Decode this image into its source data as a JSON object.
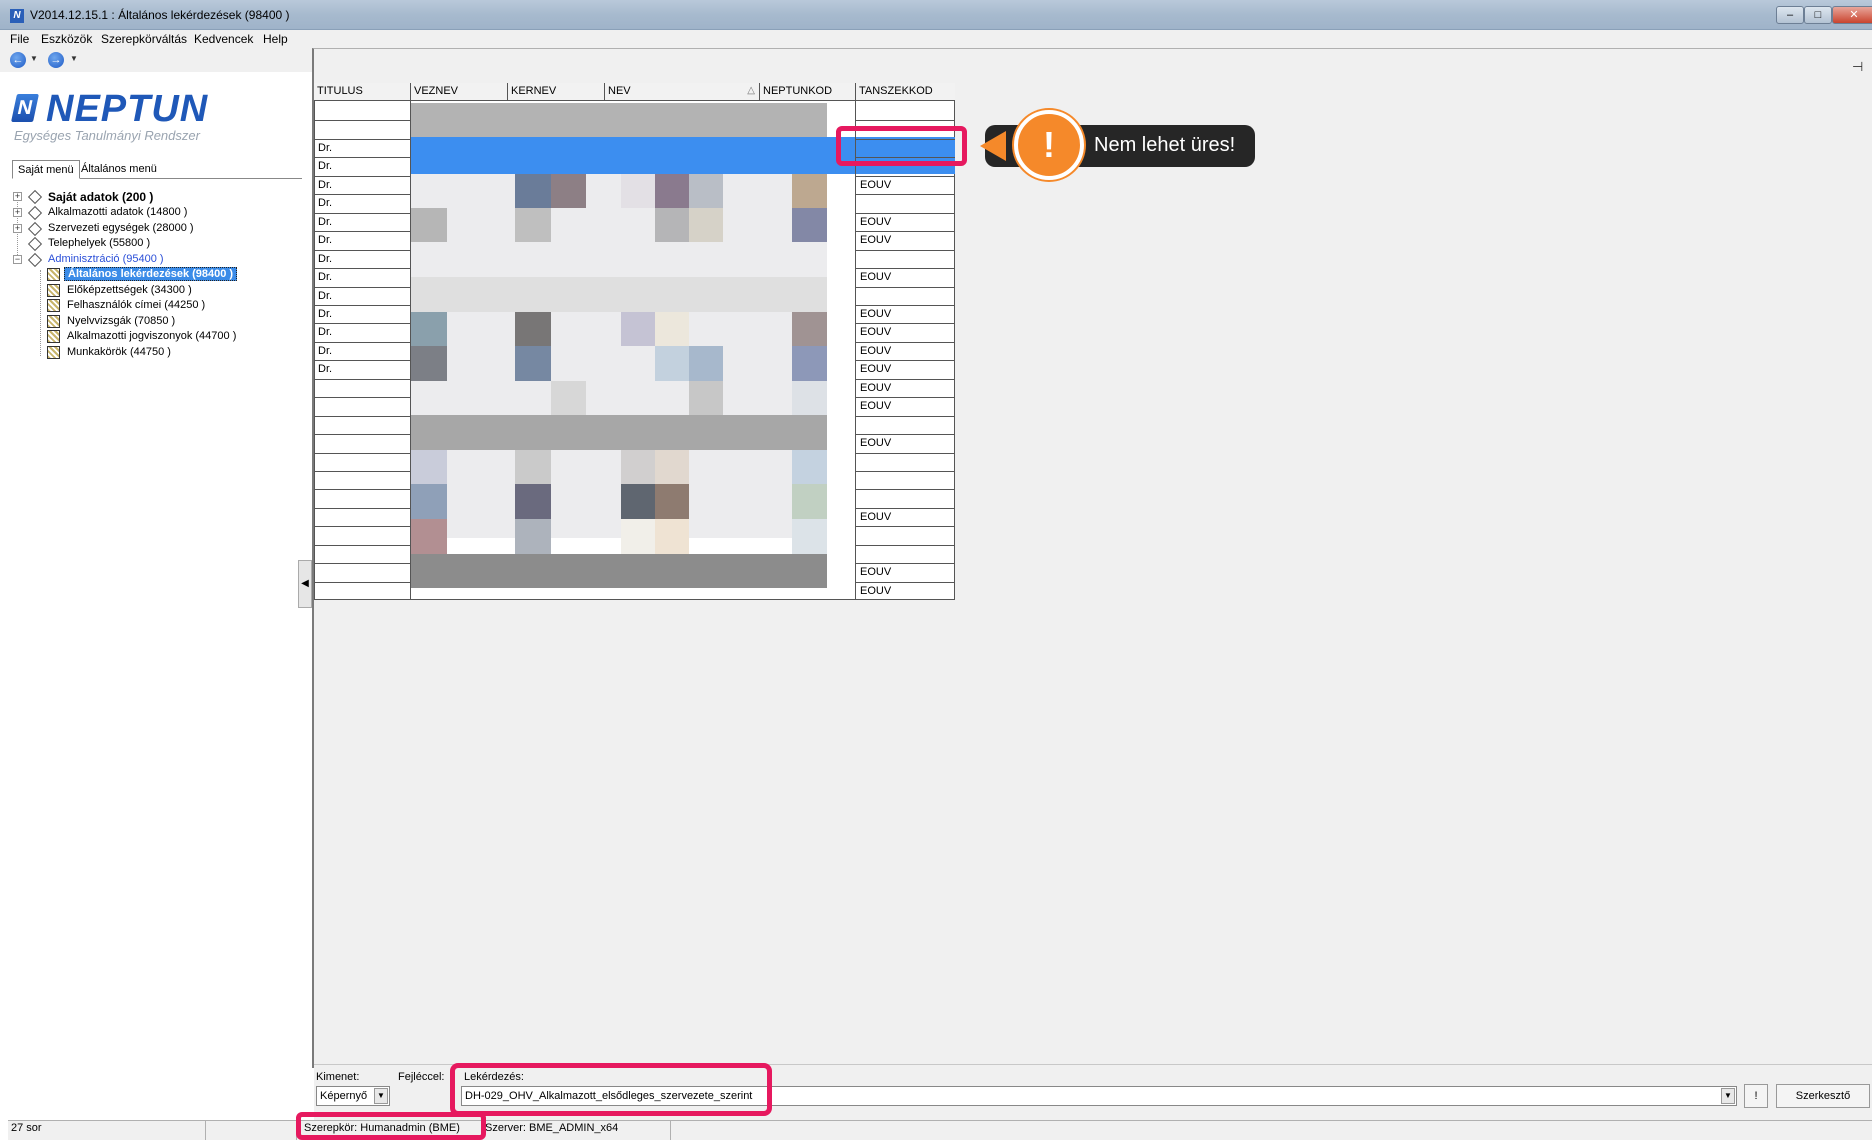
{
  "window": {
    "title": "V2014.12.15.1 : Általános lekérdezések (98400 )",
    "minimize": "–",
    "restore": "□",
    "close": "✕"
  },
  "menubar": {
    "items": [
      "File",
      "Eszközök",
      "Szerepkörváltás",
      "Kedvencek",
      "Help"
    ]
  },
  "navbar": {
    "back": "←",
    "forward": "→",
    "dropdown": "▼"
  },
  "logo": {
    "mark": "N",
    "name": "NEPTUN",
    "subtitle": "Egységes Tanulmányi Rendszer"
  },
  "left_tabs": [
    "Saját menü",
    "Általános menü"
  ],
  "tree": [
    {
      "label": "Saját adatok (200  )",
      "expander": "+"
    },
    {
      "label": "Alkalmazotti adatok (14800  )",
      "expander": "+"
    },
    {
      "label": "Szervezeti egységek (28000  )",
      "expander": "+"
    },
    {
      "label": "Telephelyek (55800  )",
      "expander": ""
    },
    {
      "label": "Adminisztráció (95400  )",
      "expander": "−"
    },
    {
      "label": "Általános lekérdezések (98400  )"
    },
    {
      "label": "Előképzettségek (34300  )"
    },
    {
      "label": "Felhasználók címei (44250  )"
    },
    {
      "label": "Nyelvvizsgák (70850  )"
    },
    {
      "label": "Alkalmazotti jogviszonyok (44700  )"
    },
    {
      "label": "Munkakörök (44750  )"
    }
  ],
  "collapse_arrow": "◀",
  "pin": "⊣",
  "grid": {
    "columns": [
      "TITULUS",
      "VEZNEV",
      "KERNEV",
      "NEV",
      "NEPTUNKOD",
      "TANSZEKKOD"
    ],
    "sort_indicator": "△",
    "titulus": [
      "",
      "",
      "Dr.",
      "Dr.",
      "Dr.",
      "Dr.",
      "Dr.",
      "Dr.",
      "Dr.",
      "Dr.",
      "Dr.",
      "Dr.",
      "Dr.",
      "Dr.",
      "Dr.",
      "",
      "",
      "",
      "",
      "",
      "",
      "",
      "",
      "",
      "",
      "",
      ""
    ],
    "tanszekkod": [
      "",
      "",
      "",
      "",
      "EOUV",
      "",
      "EOUV",
      "EOUV",
      "",
      "EOUV",
      "",
      "EOUV",
      "EOUV",
      "EOUV",
      "EOUV",
      "EOUV",
      "EOUV",
      "",
      "EOUV",
      "",
      "",
      "",
      "EOUV",
      "",
      "",
      "EOUV",
      "EOUV"
    ]
  },
  "callout": {
    "icon": "!",
    "text": "Nem lehet üres!"
  },
  "bottom": {
    "kimenet_label": "Kimenet:",
    "kimenet_value": "Képernyő",
    "fejleccel_label": "Fejléccel:",
    "lekerdezes_label": "Lekérdezés:",
    "lekerdezes_value": "DH-029_OHV_Alkalmazott_elsődleges_szervezete_szerint",
    "run_label": "!",
    "editor_label": "Szerkesztő"
  },
  "status": {
    "rows": "27 sor",
    "role": "Szerepkör: Humanadmin (BME)",
    "server": "Szerver: BME_ADMIN_x64"
  }
}
